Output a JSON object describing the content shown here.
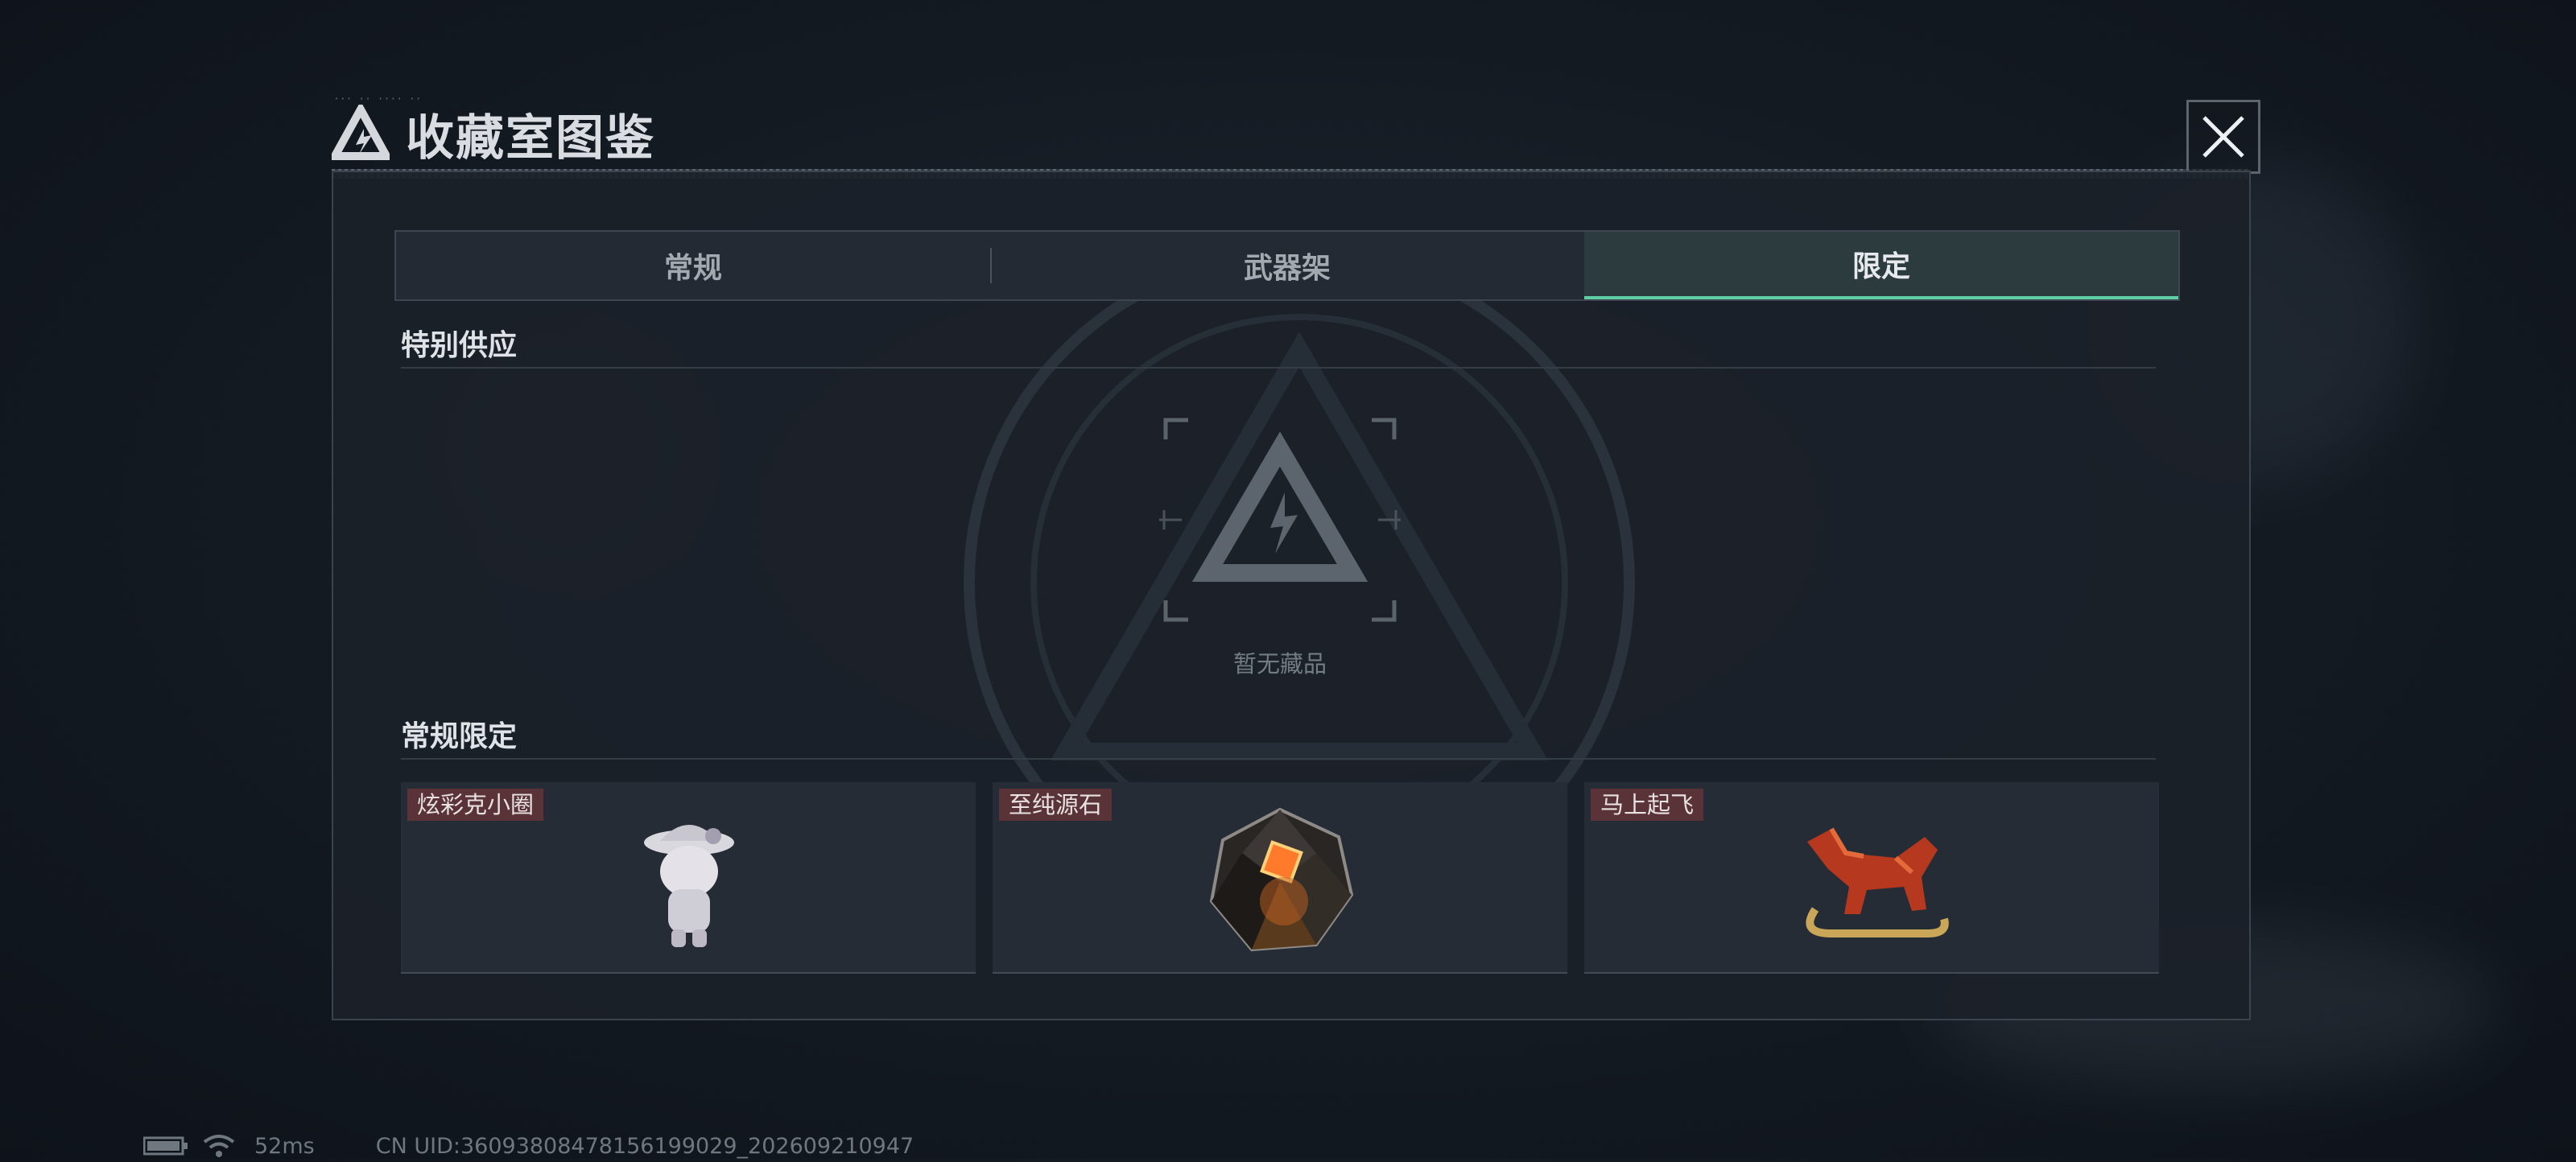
{
  "window": {
    "title": "收藏室图鉴",
    "close_icon": "close-icon"
  },
  "tabs": [
    {
      "label": "常规",
      "active": false
    },
    {
      "label": "武器架",
      "active": false
    },
    {
      "label": "限定",
      "active": true
    }
  ],
  "sections": {
    "special": {
      "title": "特别供应",
      "empty_text": "暂无藏品"
    },
    "regular": {
      "title": "常规限定",
      "items": [
        {
          "name": "炫彩克小圈",
          "icon": "figurine-icon"
        },
        {
          "name": "至纯源石",
          "icon": "originium-crystal-icon"
        },
        {
          "name": "马上起飞",
          "icon": "red-horse-statue-icon"
        }
      ]
    }
  },
  "status_bar": {
    "ping": "52ms",
    "uid": "CN UID:3609380847815619902​9_202609210947"
  },
  "colors": {
    "accent": "#5fd0a6",
    "tag_bg": "#5a3338",
    "panel_bg": "#1b2129"
  }
}
